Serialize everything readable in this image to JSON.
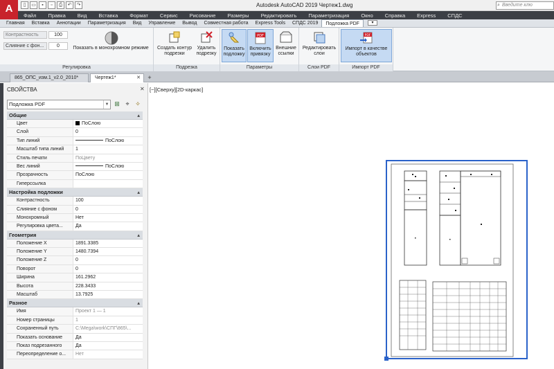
{
  "app": {
    "logo": "A",
    "title": "Autodesk AutoCAD 2019   Чертеж1.dwg",
    "search_placeholder": "Введите клю"
  },
  "menu": [
    "Файл",
    "Правка",
    "Вид",
    "Вставка",
    "Формат",
    "Сервис",
    "Рисование",
    "Размеры",
    "Редактировать",
    "Параметризация",
    "Окно",
    "Справка",
    "Express",
    "СПДС"
  ],
  "ribbon_tabs": [
    "Главная",
    "Вставка",
    "Аннотации",
    "Параметризация",
    "Вид",
    "Управление",
    "Вывод",
    "Совместная работа",
    "Express Tools",
    "СПДС 2019",
    "Подложка PDF"
  ],
  "ribbon": {
    "adjust": {
      "contrast_label": "Контрастность",
      "contrast_value": "100",
      "fade_label": "Слияние с фон...",
      "fade_value": "0",
      "mono_label": "Показать в монохромном режиме",
      "group_label": "Регулировка"
    },
    "clip": {
      "create_label": "Создать контур подрезки",
      "remove_label": "Удалить подрезку",
      "group_label": "Подрезка"
    },
    "options": {
      "show_label": "Показать подложку",
      "snap_label": "Включить привязку",
      "external_label": "Внешние ссылки",
      "group_label": "Параметры"
    },
    "layers": {
      "edit_label": "Редактировать слои",
      "group_label": "Слои PDF"
    },
    "import": {
      "import_label": "Импорт в качестве объектов",
      "group_label": "Импорт PDF"
    }
  },
  "doc_tabs": [
    {
      "label": "865_ОПС_изм.1_v2.0_2010*"
    },
    {
      "label": "Чертеж1*"
    }
  ],
  "properties": {
    "title": "СВОЙСТВА",
    "selection": "Подложка PDF",
    "categories": [
      {
        "name": "Общие",
        "rows": [
          [
            "Цвет",
            "ПоСлою"
          ],
          [
            "Слой",
            "0"
          ],
          [
            "Тип линий",
            "ПоСлою"
          ],
          [
            "Масштаб типа линий",
            "1"
          ],
          [
            "Стиль печати",
            "ПоЦвету"
          ],
          [
            "Вес линий",
            "ПоСлою"
          ],
          [
            "Прозрачность",
            "ПоСлою"
          ],
          [
            "Гиперссылка",
            ""
          ]
        ]
      },
      {
        "name": "Настройка подложки",
        "rows": [
          [
            "Контрастность",
            "100"
          ],
          [
            "Слияние с фоном",
            "0"
          ],
          [
            "Монохромный",
            "Нет"
          ],
          [
            "Регулировка цвета...",
            "Да"
          ]
        ]
      },
      {
        "name": "Геометрия",
        "rows": [
          [
            "Положение X",
            "1891.3385"
          ],
          [
            "Положение Y",
            "1480.7394"
          ],
          [
            "Положение Z",
            "0"
          ],
          [
            "Поворот",
            "0"
          ],
          [
            "Ширина",
            "161.2962"
          ],
          [
            "Высота",
            "228.3433"
          ],
          [
            "Масштаб",
            "13.7925"
          ]
        ]
      },
      {
        "name": "Разное",
        "rows": [
          [
            "Имя",
            "Проект 1 — 1"
          ],
          [
            "Номер страницы",
            "1"
          ],
          [
            "Сохраненный путь",
            "C:\\Mega\\work\\СПГ\\865\\..."
          ],
          [
            "Показать основание",
            "Да"
          ],
          [
            "Показ подрезанного",
            "Да"
          ],
          [
            "Переопределение о...",
            "Нет"
          ]
        ]
      }
    ]
  },
  "viewport": {
    "label": "[−][Сверху][2D-каркас]"
  }
}
